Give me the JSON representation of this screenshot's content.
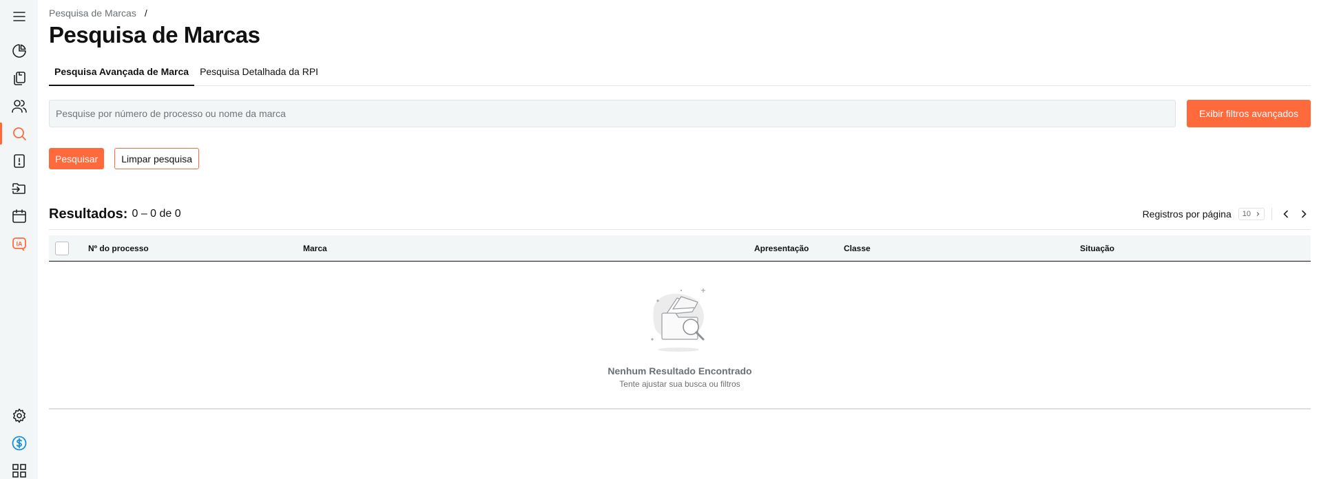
{
  "sidebar": {
    "items": [
      {
        "icon": "menu-icon"
      },
      {
        "icon": "pie-chart-icon"
      },
      {
        "icon": "documents-icon"
      },
      {
        "icon": "users-icon"
      },
      {
        "icon": "search-icon",
        "active": true
      },
      {
        "icon": "alert-file-icon"
      },
      {
        "icon": "folder-import-icon"
      },
      {
        "icon": "calendar-icon"
      },
      {
        "icon": "ia-icon",
        "label": "IA"
      },
      {
        "icon": "gear-icon"
      },
      {
        "icon": "dollar-circle-icon"
      },
      {
        "icon": "grid-icon"
      }
    ]
  },
  "breadcrumb": {
    "item": "Pesquisa de Marcas",
    "separator": "/"
  },
  "page_title": "Pesquisa de Marcas",
  "tabs": [
    {
      "label": "Pesquisa Avançada de Marca",
      "active": true
    },
    {
      "label": "Pesquisa Detalhada da RPI",
      "active": false
    }
  ],
  "search": {
    "placeholder": "Pesquise por número de processo ou nome da marca",
    "value": "",
    "advanced_filters_label": "Exibir filtros avançados"
  },
  "actions": {
    "search_label": "Pesquisar",
    "clear_label": "Limpar pesquisa"
  },
  "results": {
    "title": "Resultados:",
    "range": "0 – 0 de 0",
    "per_page_label": "Registros por página",
    "per_page_value": "10"
  },
  "table": {
    "columns": [
      "Nº do processo",
      "Marca",
      "Apresentação",
      "Classe",
      "Situação"
    ],
    "rows": []
  },
  "empty_state": {
    "title": "Nenhum Resultado Encontrado",
    "subtitle": "Tente ajustar sua busca ou filtros"
  },
  "colors": {
    "accent": "#ff6a3d",
    "sidebar_bg": "#f3f6f7",
    "dollar_icon": "#1a8fd1"
  }
}
